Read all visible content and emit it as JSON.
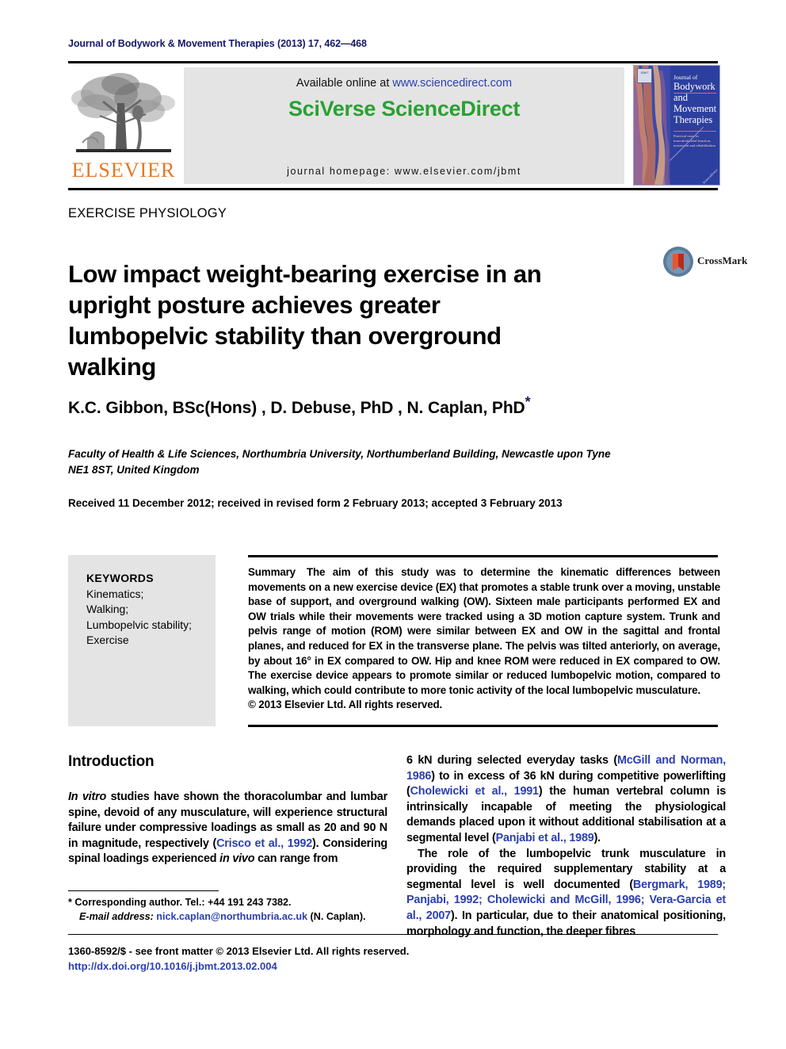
{
  "running_head": {
    "text": "Journal of Bodywork & Movement Therapies (2013) 17, 462—468"
  },
  "publisher": {
    "name": "ELSEVIER",
    "logo_icon": "elsevier-tree-icon"
  },
  "sciencedirect_banner": {
    "available_prefix": "Available online at ",
    "available_url": "www.sciencedirect.com",
    "logo_text": "SciVerse ScienceDirect",
    "homepage": "journal homepage: www.elsevier.com/jbmt",
    "logo_color": "#2aa032",
    "url_color": "#2b3fb0",
    "background": "#e4e4e4"
  },
  "journal_cover": {
    "line1": "Journal of",
    "line2": "Bodywork",
    "line3": "and",
    "line4": "Movement",
    "line5": "Therapies",
    "subtitle": "Practical cases in musculoskeletal function, movement and rehabilitation",
    "corner_note": "ScienceDirect",
    "background": "#2d3f9e"
  },
  "section_label": "EXERCISE PHYSIOLOGY",
  "title": "Low impact weight-bearing exercise in an upright posture achieves greater lumbopelvic stability than overground walking",
  "crossmark": {
    "label": "CrossMark",
    "icon": "crossmark-logo-icon"
  },
  "authors": {
    "text": "K.C. Gibbon, BSc(Hons) , D. Debuse, PhD , N. Caplan, PhD",
    "corresponding_marker": "*"
  },
  "affiliation": "Faculty of Health & Life Sciences, Northumbria University, Northumberland Building, Newcastle upon Tyne NE1 8ST, United Kingdom",
  "received": "Received 11 December 2012; received in revised form 2 February 2013; accepted 3 February 2013",
  "keywords": {
    "heading": "KEYWORDS",
    "list": "Kinematics;\nWalking;\nLumbopelvic stability;\nExercise"
  },
  "abstract": {
    "heading": "Summary",
    "body": "The aim of this study was to determine the kinematic differences between movements on a new exercise device (EX) that promotes a stable trunk over a moving, unstable base of support, and overground walking (OW). Sixteen male participants performed EX and OW trials while their movements were tracked using a 3D motion capture system. Trunk and pelvis range of motion (ROM) were similar between EX and OW in the sagittal and frontal planes, and reduced for EX in the transverse plane. The pelvis was tilted anteriorly, on average, by about 16° in EX compared to OW. Hip and knee ROM were reduced in EX compared to OW. The exercise device appears to promote similar or reduced lumbopelvic motion, compared to walking, which could contribute to more tonic activity of the local lumbopelvic musculature.",
    "copyright": "© 2013 Elsevier Ltd. All rights reserved."
  },
  "introduction": {
    "heading": "Introduction",
    "left_paragraph_pre": "",
    "left_italic_1": "In vitro",
    "left_part_1": " studies have shown the thoracolumbar and lumbar spine, devoid of any musculature, will experience structural failure under compressive loadings as small as 20 and 90 N in magnitude, respectively (",
    "left_cite_1": "Crisco et al., 1992",
    "left_part_2": "). Considering spinal loadings experienced ",
    "left_italic_2": "in vivo",
    "left_part_3": " can range from",
    "right_part_1": "6 kN during selected everyday tasks (",
    "right_cite_1": "McGill and Norman, 1986",
    "right_part_2": ") to in excess of 36 kN during competitive powerlifting (",
    "right_cite_2": "Cholewicki et al., 1991",
    "right_part_3": ") the human vertebral column is intrinsically incapable of meeting the physiological demands placed upon it without additional stabilisation at a segmental level (",
    "right_cite_3": "Panjabi et al., 1989",
    "right_part_4": ").",
    "right_p2_part_1": "The role of the lumbopelvic trunk musculature in providing the required supplementary stability at a segmental level is well documented (",
    "right_p2_cite_1": "Bergmark, 1989; Panjabi, 1992; Cholewicki and McGill, 1996; Vera-Garcia et al., 2007",
    "right_p2_part_2": "). In particular, due to their anatomical positioning, morphology and function, the deeper fibres"
  },
  "footnotes": {
    "corresponding": "* Corresponding author. Tel.: +44 191 243 7382.",
    "email_label": "E-mail address:",
    "email": "nick.caplan@northumbria.ac.uk",
    "email_suffix": " (N. Caplan)."
  },
  "imprint": {
    "line1": "1360-8592/$ - see front matter © 2013 Elsevier Ltd. All rights reserved.",
    "doi": "http://dx.doi.org/10.1016/j.jbmt.2013.02.004"
  }
}
